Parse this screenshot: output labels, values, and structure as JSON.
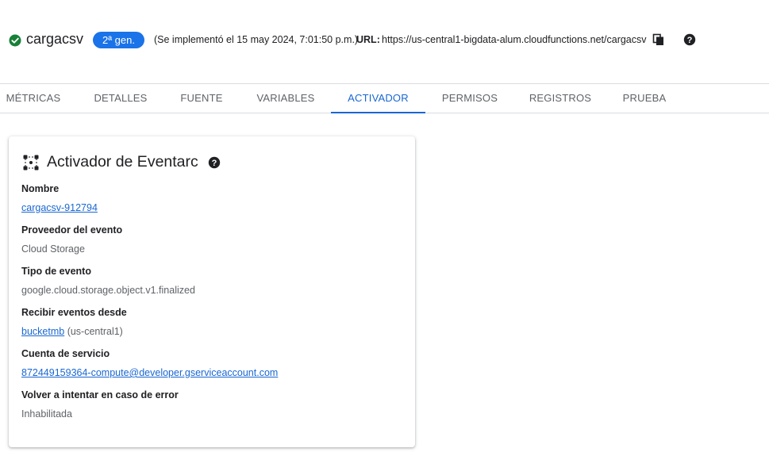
{
  "header": {
    "function_name": "cargacsv",
    "generation_badge": "2ª gen.",
    "deploy_info": "(Se implementó el 15 may 2024, 7:01:50 p.m.)",
    "url_label": "URL:",
    "url_value": "https://us-central1-bigdata-alum.cloudfunctions.net/cargacsv",
    "status_icon": "check-circle-icon",
    "copy_icon": "copy-icon",
    "help_icon": "help-icon"
  },
  "tabs": [
    {
      "label": "MÉTRICAS",
      "active": false
    },
    {
      "label": "DETALLES",
      "active": false
    },
    {
      "label": "FUENTE",
      "active": false
    },
    {
      "label": "VARIABLES",
      "active": false
    },
    {
      "label": "ACTIVADOR",
      "active": true
    },
    {
      "label": "PERMISOS",
      "active": false
    },
    {
      "label": "REGISTROS",
      "active": false
    },
    {
      "label": "PRUEBA",
      "active": false
    }
  ],
  "card": {
    "title": "Activador de Eventarc",
    "fields": {
      "name_label": "Nombre",
      "name_value": "cargacsv-912794",
      "provider_label": "Proveedor del evento",
      "provider_value": "Cloud Storage",
      "event_type_label": "Tipo de evento",
      "event_type_value": "google.cloud.storage.object.v1.finalized",
      "receive_from_label": "Recibir eventos desde",
      "receive_from_bucket": "bucketmb",
      "receive_from_region": "(us-central1)",
      "service_account_label": "Cuenta de servicio",
      "service_account_value": "872449159364-compute@developer.gserviceaccount.com",
      "retry_label": "Volver a intentar en caso de error",
      "retry_value": "Inhabilitada"
    }
  },
  "colors": {
    "accent": "#1967d2",
    "badge_bg": "#1a73e8",
    "status_green": "#188038",
    "text_primary": "#202124",
    "text_secondary": "#5f6368",
    "divider": "#dadce0"
  }
}
